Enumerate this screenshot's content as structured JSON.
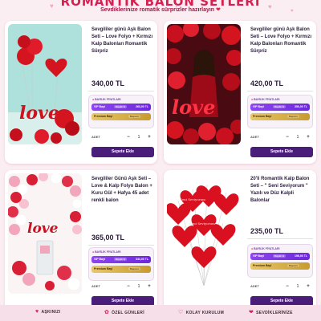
{
  "hero": {
    "title": "ROMANTİK BALON SETLERİ",
    "subtitle": "Sevdiklerinize romatik sürprizler hazırlayın",
    "heart": "❤"
  },
  "products": [
    {
      "title": "Sevgililer günü Aşk Balon Seti – Love Folyo + Kırmızı Kalp Balonları Romantik Sürpriz",
      "price": "340,00 TL",
      "bayi_title": "BAYİLİK FİYATLARI",
      "vip_label": "VIP Bayi",
      "vip_badge": "Bayilik %",
      "vip_price": "263,00 TL",
      "premium_label": "Premium Bayi",
      "premium_badge": "Başvuru",
      "qty_label": "ADET",
      "qty": "1",
      "minus": "−",
      "plus": "+",
      "cart": "Sepete Ekle"
    },
    {
      "title": "Sevgililer günü Aşk Balon Seti – Love Folyo + Kırmızı Kalp Balonları Romantik Sürpriz",
      "price": "420,00 TL",
      "bayi_title": "BAYİLİK FİYATLARI",
      "vip_label": "VIP Bayi",
      "vip_badge": "Bayilik %",
      "vip_price": "350,00 TL",
      "premium_label": "Premium Bayi",
      "premium_badge": "Başvuru",
      "qty_label": "ADET",
      "qty": "1",
      "minus": "−",
      "plus": "+",
      "cart": "Sepete Ekle"
    },
    {
      "title": "Sevgililer Günü Aşk Seti – Love & Kalp Folyo Balon + Kuru Gül + Hafya 45 adet renkli balon",
      "price": "365,00 TL",
      "bayi_title": "BAYİLİK FİYATLARI",
      "vip_label": "VIP Bayi",
      "vip_badge": "Bayilik %",
      "vip_price": "344,00 TL",
      "premium_label": "Premium Bayi",
      "premium_badge": "Başvuru",
      "qty_label": "ADET",
      "qty": "1",
      "minus": "−",
      "plus": "+",
      "cart": "Sepete Ekle"
    },
    {
      "title": "20'li Romantik Kalp Balon Seti – \" Seni Seviyorum \" Yazılı ve Düz Kalpli Balonlar",
      "price": "235,00 TL",
      "bayi_title": "BAYİLİK FİYATLARI",
      "vip_label": "VIP Bayi",
      "vip_badge": "Bayilik %",
      "vip_price": "198,00 TL",
      "premium_label": "Premium Bayi",
      "premium_badge": "Başvuru",
      "qty_label": "ADET",
      "qty": "1",
      "minus": "−",
      "plus": "+",
      "cart": "Sepete Ekle"
    }
  ],
  "features": [
    {
      "icon": "heart-icon",
      "label": "AŞKINIZI"
    },
    {
      "icon": "gift-icon",
      "label": "ÖZEL GÜNLERİ"
    },
    {
      "icon": "balloon-icon",
      "label": "KOLAY KURULUM"
    },
    {
      "icon": "love-icon",
      "label": "SEVDİKLERİNİZE"
    }
  ],
  "colors": {
    "accent": "#d81f52",
    "button": "#4a1d7a",
    "vip": "#7c3aed",
    "premium": "#d4ab45",
    "background": "#fbeef3"
  }
}
